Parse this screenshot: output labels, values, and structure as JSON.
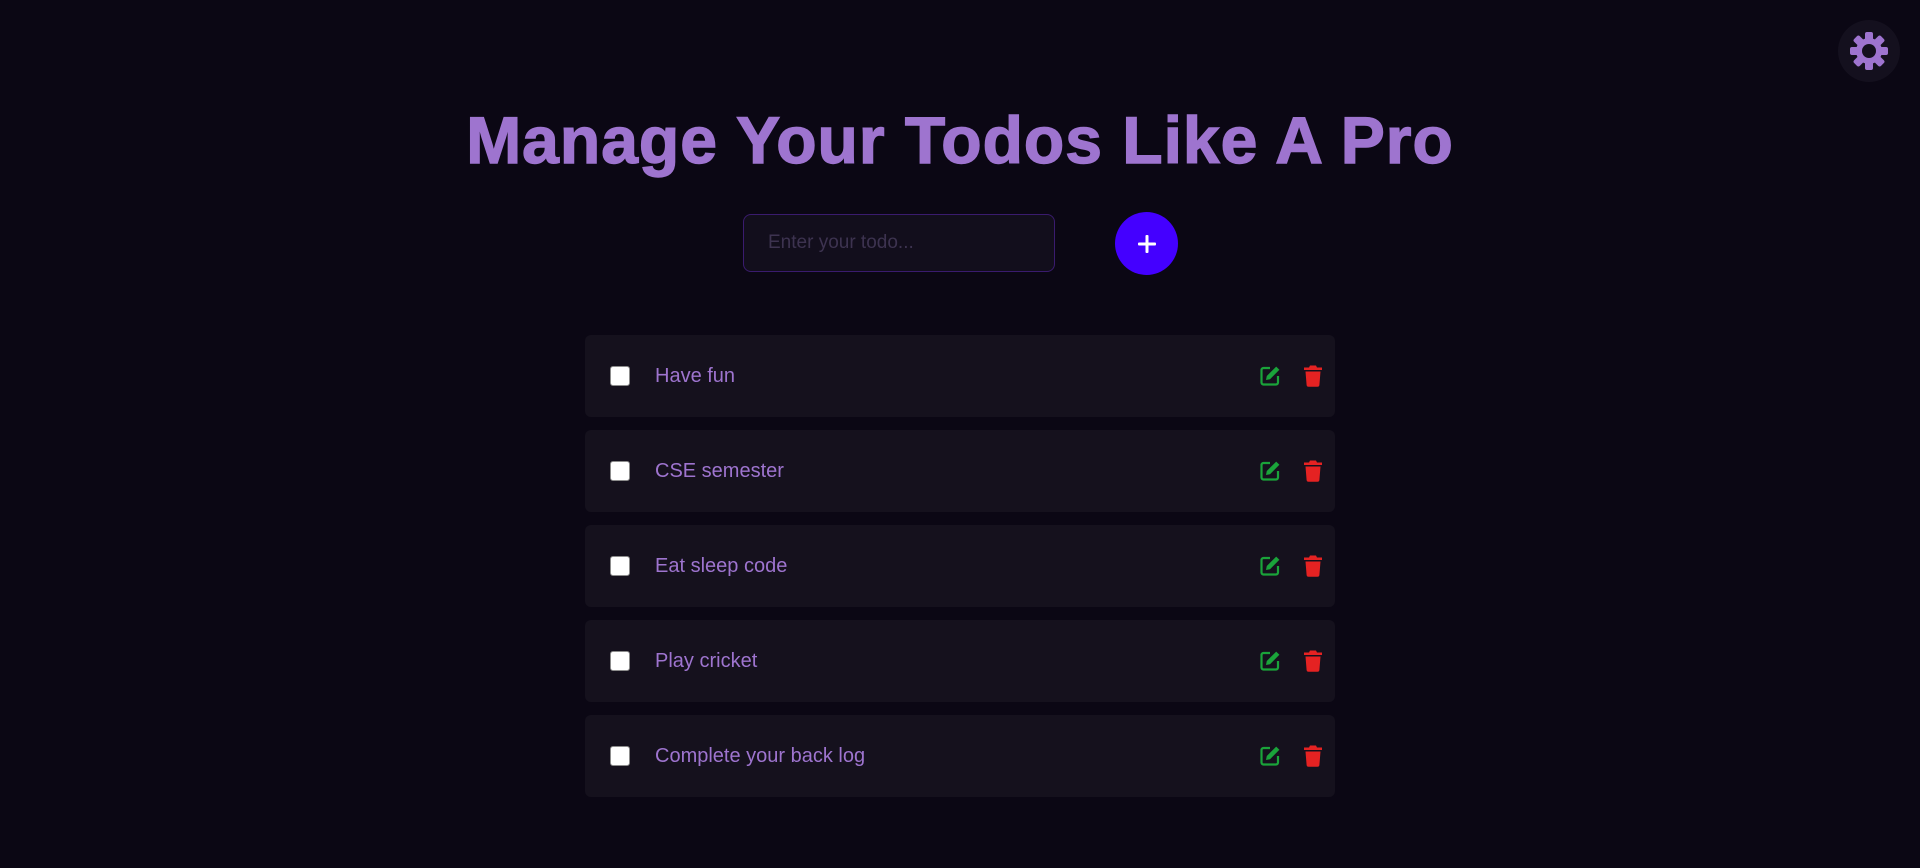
{
  "header": {
    "title": "Manage Your Todos Like A Pro"
  },
  "theme_toggle": {
    "icon": "gear-icon"
  },
  "new_todo": {
    "value": "",
    "placeholder": "Enter your todo...",
    "add_icon": "plus-icon"
  },
  "colors": {
    "background": "#0b0714",
    "accent": "#9e74cf",
    "add_button": "#4400ff",
    "edit": "#1aa33a",
    "delete": "#e52222",
    "item_background": "#15111d"
  },
  "todos": [
    {
      "text": "Have fun",
      "done": false
    },
    {
      "text": "CSE semester",
      "done": false
    },
    {
      "text": "Eat sleep code",
      "done": false
    },
    {
      "text": "Play cricket",
      "done": false
    },
    {
      "text": "Complete your back log",
      "done": false
    }
  ]
}
